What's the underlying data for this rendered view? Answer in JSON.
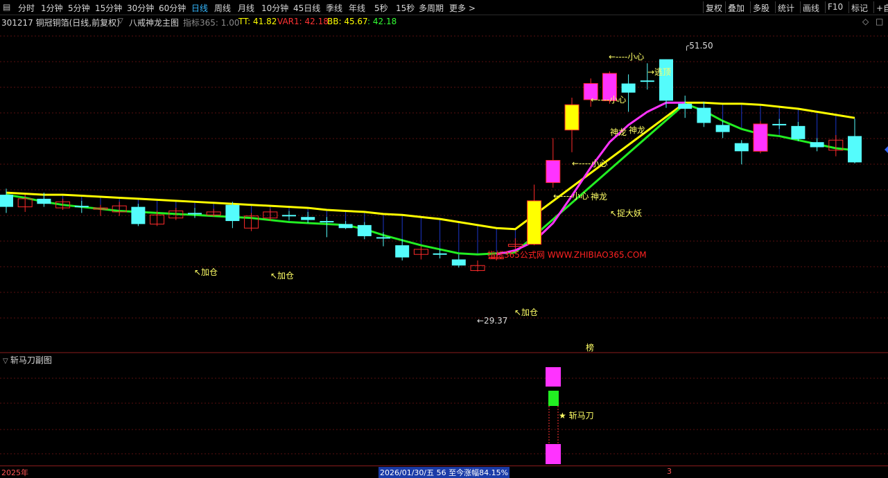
{
  "toolbar": {
    "periods": [
      "分时",
      "1分钟",
      "5分钟",
      "15分钟",
      "30分钟",
      "60分钟",
      "日线",
      "周线",
      "月线",
      "10分钟",
      "45日线",
      "季线",
      "年线",
      "5秒",
      "15秒",
      "多周期",
      "更多 >"
    ],
    "active_index": 6,
    "right_buttons": [
      "复权",
      "叠加",
      "多股",
      "统计",
      "画线",
      "F10",
      "标记",
      "+自选"
    ]
  },
  "info": {
    "stock": "301217 铜冠铜箔(日线,前复权)",
    "indicator_name": "八戒神龙主图",
    "source": "指标365: 1.00",
    "tt": "TT: 41.82",
    "var1": "VAR1: 42.18",
    "bb": "BB: 45.67",
    "bb2": ": 42.18"
  },
  "colors": {
    "up": "#ff2b2b",
    "down": "#54fcfc",
    "magenta": "#ff33ff",
    "yellow": "#ffff00",
    "green": "#22ee22",
    "annotation": "#ffff66",
    "grid": "#5a1010"
  },
  "annotations": {
    "low_price": "29.37",
    "high_price": "51.50",
    "add_position": "加仓",
    "careful": "小心",
    "dragon": "神龙",
    "catch_demon": "捉大妖",
    "escape": "逃顶",
    "watermark": "指标365公式网 WWW.ZHIBIAO365.COM",
    "bang": "榜",
    "knife": "斩马刀"
  },
  "sub_panel": {
    "title": "斩马刀副图"
  },
  "status": {
    "year": "2025年",
    "date_info": "2026/01/30/五 56 至今涨幅84.15%",
    "marker": "3"
  },
  "chart_data": {
    "type": "candlestick",
    "y_range": [
      27.4,
      54.6
    ],
    "candles": [
      {
        "o": 40.0,
        "c": 38.8,
        "h": 40.6,
        "l": 38.2
      },
      {
        "o": 38.8,
        "c": 39.6,
        "h": 40.0,
        "l": 38.3
      },
      {
        "o": 39.6,
        "c": 39.1,
        "h": 40.2,
        "l": 38.8
      },
      {
        "o": 38.7,
        "c": 39.3,
        "h": 39.6,
        "l": 38.5
      },
      {
        "o": 38.8,
        "c": 38.9,
        "h": 39.4,
        "l": 38.2
      },
      {
        "o": 38.6,
        "c": 38.7,
        "h": 39.0,
        "l": 37.9
      },
      {
        "o": 38.3,
        "c": 38.9,
        "h": 39.3,
        "l": 37.9
      },
      {
        "o": 38.8,
        "c": 37.1,
        "h": 39.1,
        "l": 36.9
      },
      {
        "o": 37.1,
        "c": 38.0,
        "h": 38.4,
        "l": 36.9
      },
      {
        "o": 37.7,
        "c": 38.4,
        "h": 38.7,
        "l": 37.5
      },
      {
        "o": 38.2,
        "c": 38.2,
        "h": 38.7,
        "l": 37.7
      },
      {
        "o": 38.0,
        "c": 38.3,
        "h": 38.6,
        "l": 37.8
      },
      {
        "o": 39.0,
        "c": 37.4,
        "h": 39.3,
        "l": 36.7
      },
      {
        "o": 36.7,
        "c": 37.9,
        "h": 38.2,
        "l": 36.4
      },
      {
        "o": 37.7,
        "c": 38.3,
        "h": 38.6,
        "l": 37.4
      },
      {
        "o": 38.0,
        "c": 37.9,
        "h": 38.4,
        "l": 37.5
      },
      {
        "o": 37.8,
        "c": 37.5,
        "h": 38.3,
        "l": 37.2
      },
      {
        "o": 37.4,
        "c": 37.3,
        "h": 37.8,
        "l": 35.8
      },
      {
        "o": 36.7,
        "c": 37.1,
        "h": 37.4,
        "l": 36.6
      },
      {
        "o": 37.0,
        "c": 35.9,
        "h": 37.3,
        "l": 35.6
      },
      {
        "o": 35.8,
        "c": 35.7,
        "h": 36.3,
        "l": 34.9
      },
      {
        "o": 35.0,
        "c": 33.8,
        "h": 35.6,
        "l": 33.5
      },
      {
        "o": 34.1,
        "c": 34.6,
        "h": 34.9,
        "l": 33.6
      },
      {
        "o": 34.2,
        "c": 34.1,
        "h": 34.6,
        "l": 33.7
      },
      {
        "o": 33.6,
        "c": 33.0,
        "h": 34.1,
        "l": 32.8
      },
      {
        "o": 32.5,
        "c": 33.0,
        "h": 33.5,
        "l": 32.4
      },
      {
        "o": 33.7,
        "c": 33.8,
        "h": 34.0,
        "l": 33.5
      },
      {
        "o": 34.9,
        "c": 35.1,
        "h": 35.7,
        "l": 34.6
      },
      {
        "o": 35.1,
        "c": 39.4,
        "h": 41.0,
        "l": 35.0
      },
      {
        "o": 41.2,
        "c": 43.4,
        "h": 45.6,
        "l": 40.7
      },
      {
        "o": 46.4,
        "c": 48.9,
        "h": 49.6,
        "l": 44.2
      },
      {
        "o": 49.4,
        "c": 51.0,
        "h": 51.5,
        "l": 48.7
      },
      {
        "o": 49.3,
        "c": 52.0,
        "h": 52.2,
        "l": 49.0
      },
      {
        "o": 51.0,
        "c": 50.1,
        "h": 51.9,
        "l": 48.2
      },
      {
        "o": 51.3,
        "c": 51.2,
        "h": 53.0,
        "l": 50.4
      },
      {
        "o": 53.4,
        "c": 49.3,
        "h": 53.4,
        "l": 48.6
      },
      {
        "o": 49.0,
        "c": 48.5,
        "h": 49.8,
        "l": 47.6
      },
      {
        "o": 48.6,
        "c": 47.1,
        "h": 49.2,
        "l": 46.7
      },
      {
        "o": 46.9,
        "c": 46.2,
        "h": 47.3,
        "l": 45.6
      },
      {
        "o": 45.1,
        "c": 44.3,
        "h": 45.4,
        "l": 43.0
      },
      {
        "o": 44.3,
        "c": 47.0,
        "h": 47.3,
        "l": 44.1
      },
      {
        "o": 47.0,
        "c": 47.0,
        "h": 47.5,
        "l": 46.5
      },
      {
        "o": 46.8,
        "c": 45.5,
        "h": 47.2,
        "l": 45.3
      },
      {
        "o": 45.2,
        "c": 44.7,
        "h": 45.6,
        "l": 44.3
      },
      {
        "o": 44.4,
        "c": 45.4,
        "h": 45.9,
        "l": 43.8
      },
      {
        "o": 45.8,
        "c": 43.2,
        "h": 47.5,
        "l": 43.1
      }
    ],
    "candle_styles": [
      "down",
      "up",
      "down",
      "up",
      "down",
      "up",
      "up",
      "down",
      "up",
      "up",
      "down",
      "up",
      "down",
      "up",
      "up",
      "down",
      "down",
      "down",
      "down",
      "down",
      "down",
      "down",
      "up",
      "down",
      "down",
      "up",
      "up",
      "up",
      "yellow",
      "magenta",
      "yellow",
      "magenta",
      "magenta",
      "down",
      "down",
      "down",
      "down",
      "down",
      "down",
      "down",
      "magenta",
      "down",
      "down",
      "down",
      "up",
      "down"
    ],
    "yellow_line": [
      40.2,
      40.1,
      40.0,
      40.0,
      39.9,
      39.8,
      39.7,
      39.6,
      39.5,
      39.4,
      39.3,
      39.2,
      39.1,
      39.0,
      38.9,
      38.8,
      38.7,
      38.5,
      38.4,
      38.3,
      38.1,
      38.0,
      37.8,
      37.6,
      37.3,
      37.0,
      36.7,
      36.6,
      null,
      null,
      null,
      null,
      null,
      null,
      null,
      null,
      49.1,
      49.1,
      49.0,
      49.0,
      48.9,
      48.7,
      48.5,
      48.2,
      47.9,
      47.6
    ],
    "green_line": [
      40.0,
      39.7,
      39.3,
      39.0,
      38.8,
      38.6,
      38.4,
      38.3,
      38.2,
      38.1,
      38.0,
      37.9,
      37.8,
      37.7,
      37.5,
      37.3,
      37.2,
      37.1,
      37.0,
      36.6,
      36.0,
      35.5,
      35.0,
      34.6,
      34.2,
      34.1,
      34.2,
      34.3,
      null,
      null,
      null,
      null,
      null,
      null,
      null,
      null,
      49.0,
      48.3,
      47.3,
      46.5,
      46.0,
      45.8,
      45.4,
      45.0,
      44.6,
      44.4
    ],
    "magenta_line": [
      null,
      null,
      null,
      null,
      null,
      null,
      null,
      null,
      null,
      null,
      null,
      null,
      null,
      null,
      null,
      null,
      null,
      null,
      null,
      null,
      null,
      null,
      null,
      null,
      null,
      null,
      34.1,
      34.5,
      35.4,
      37.2,
      39.9,
      42.7,
      45.2,
      46.9,
      48.2,
      49.1,
      49.1
    ]
  }
}
